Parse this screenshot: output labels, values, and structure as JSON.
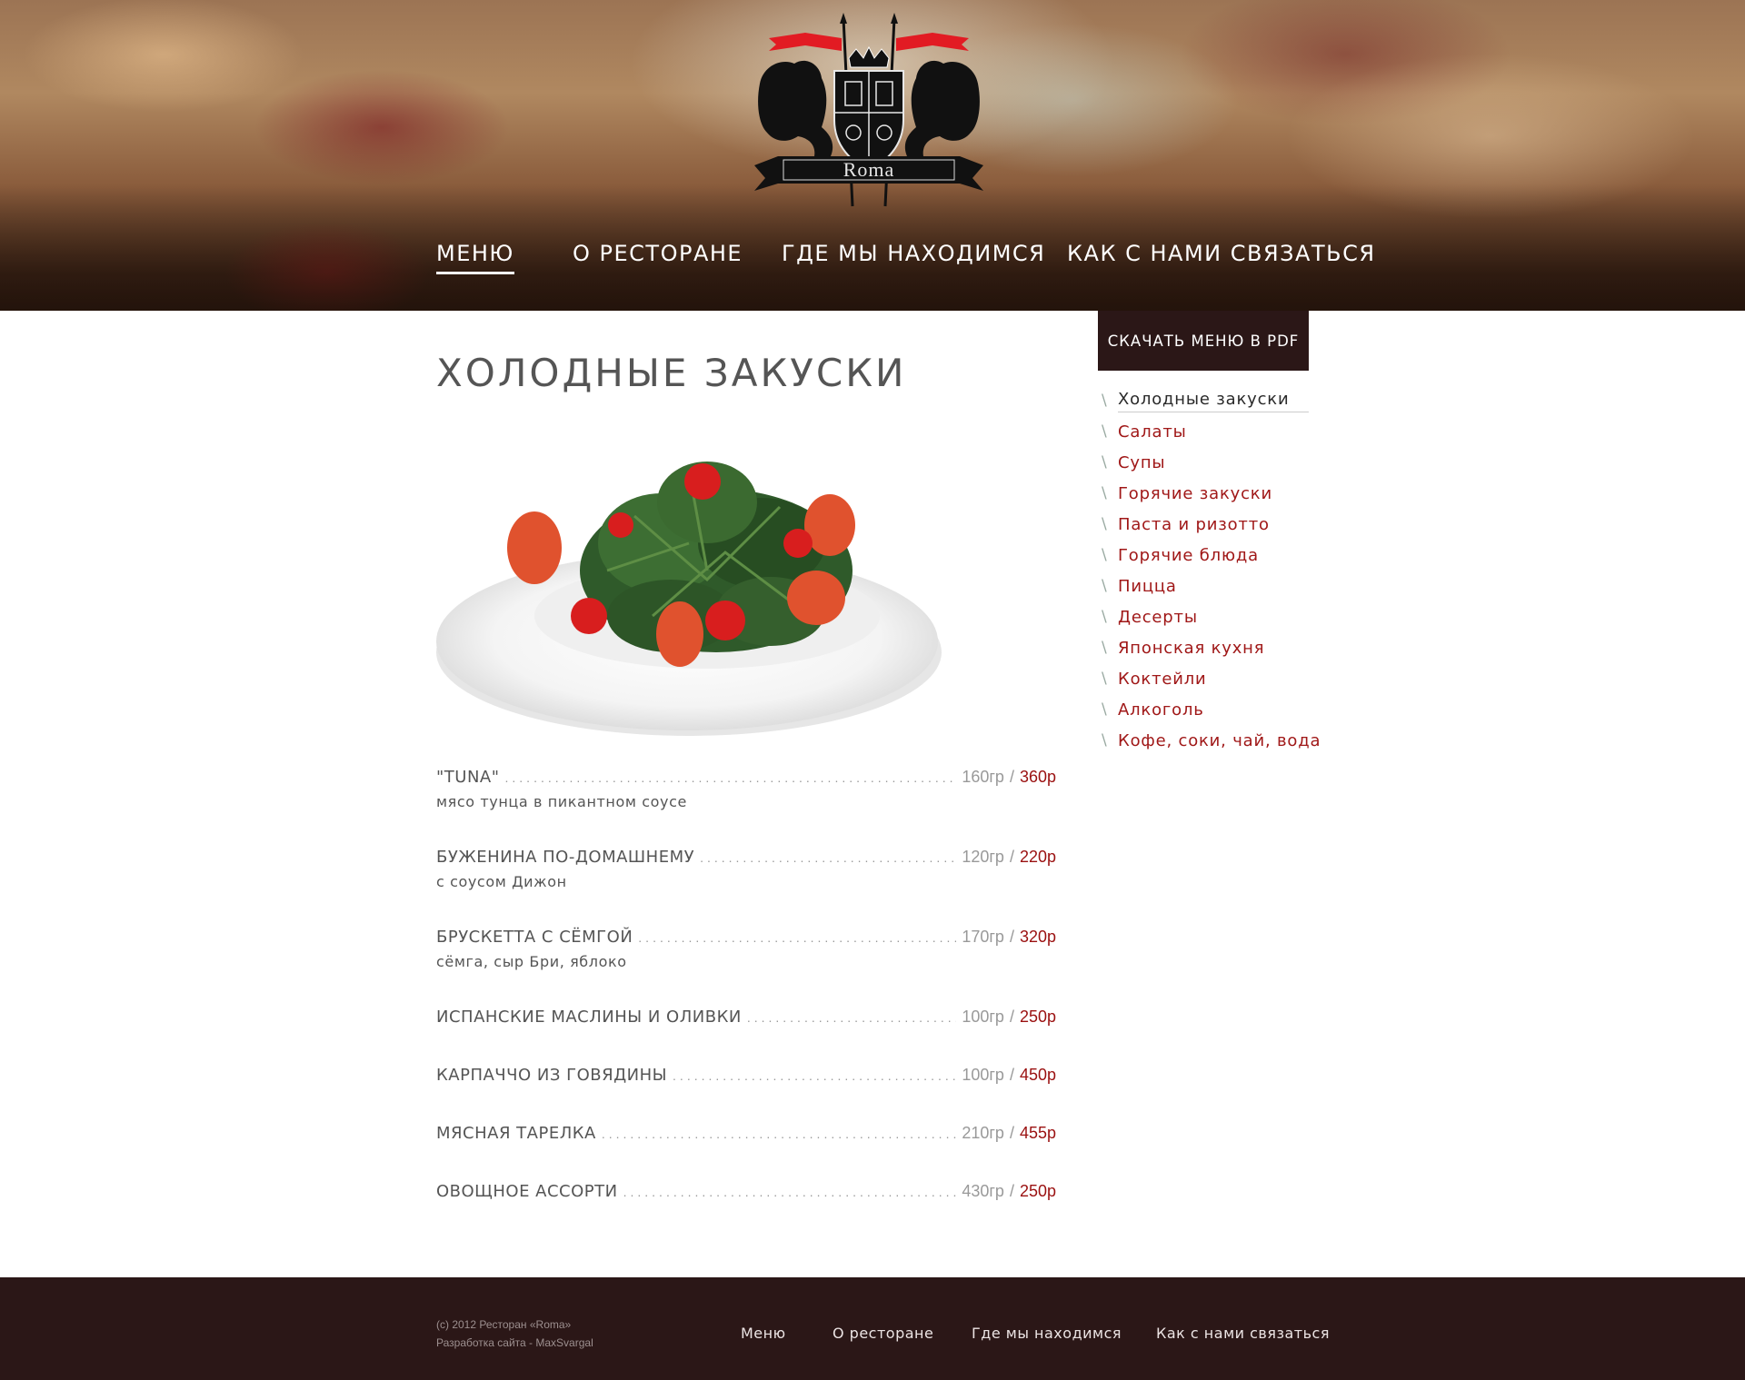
{
  "brand": {
    "logo_text": "Roma"
  },
  "nav": {
    "items": [
      {
        "label": "Меню",
        "active": true
      },
      {
        "label": "О ресторане",
        "active": false
      },
      {
        "label": "Где мы находимся",
        "active": false
      },
      {
        "label": "Как с нами связаться",
        "active": false
      }
    ]
  },
  "main": {
    "title": "Холодные закуски",
    "items": [
      {
        "name": "\"Tuna\"",
        "weight": "160гр",
        "price": "360р",
        "desc": "мясо тунца в пикантном соусе"
      },
      {
        "name": "Буженина по-домашнему",
        "weight": "120гр",
        "price": "220р",
        "desc": "с соусом Дижон"
      },
      {
        "name": "Брускетта с сёмгой",
        "weight": "170гр",
        "price": "320р",
        "desc": "сёмга, сыр Бри, яблоко"
      },
      {
        "name": "Испанские маслины и оливки",
        "weight": "100гр",
        "price": "250р",
        "desc": ""
      },
      {
        "name": "Карпаччо из говядины",
        "weight": "100гр",
        "price": "450р",
        "desc": ""
      },
      {
        "name": "Мясная тарелка",
        "weight": "210гр",
        "price": "455р",
        "desc": ""
      },
      {
        "name": "Овощное ассорти",
        "weight": "430гр",
        "price": "250р",
        "desc": ""
      }
    ]
  },
  "sidebar": {
    "pdf_button": "Скачать меню в PDF",
    "slash": "\\",
    "categories": [
      {
        "label": "Холодные закуски",
        "active": true
      },
      {
        "label": "Салаты",
        "active": false
      },
      {
        "label": "Супы",
        "active": false
      },
      {
        "label": "Горячие закуски",
        "active": false
      },
      {
        "label": "Паста и ризотто",
        "active": false
      },
      {
        "label": "Горячие блюда",
        "active": false
      },
      {
        "label": "Пицца",
        "active": false
      },
      {
        "label": "Десерты",
        "active": false
      },
      {
        "label": "Японская кухня",
        "active": false
      },
      {
        "label": "Коктейли",
        "active": false
      },
      {
        "label": "Алкоголь",
        "active": false
      },
      {
        "label": "Кофе, соки, чай, вода",
        "active": false
      }
    ]
  },
  "footer": {
    "copyright": "(c) 2012 Ресторан «Roma»",
    "developer": "Разработка сайта - MaxSvargal",
    "nav": [
      "Меню",
      "О ресторане",
      "Где мы находимся",
      "Как с нами связаться"
    ]
  },
  "colors": {
    "accent": "#9a1010",
    "dark": "#2b1717",
    "text": "#555555"
  }
}
